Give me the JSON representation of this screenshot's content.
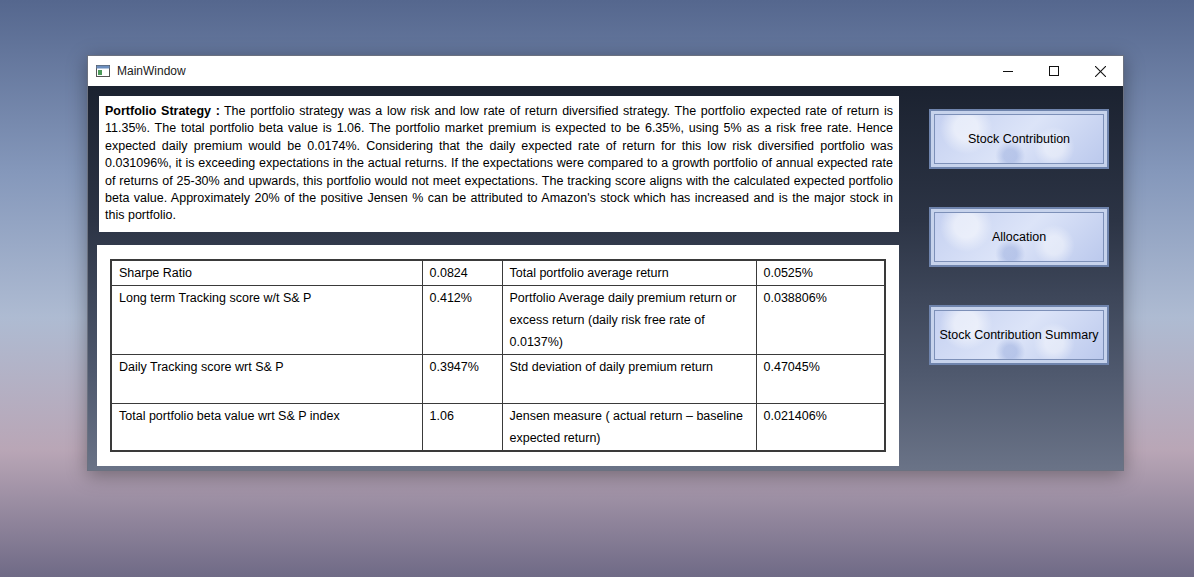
{
  "window": {
    "title": "MainWindow"
  },
  "strategy": {
    "heading": "Portfolio Strategy :",
    "body": "The portfolio strategy was a low risk and low rate of return diversified strategy.  The portfolio expected rate of return is 11.35%. The total portfolio beta value is 1.06. The portfolio market premium is expected to be 6.35%, using 5% as a risk free rate. Hence expected daily premium would be 0.0174%. Considering that the daily expected rate of return for this low risk diversified portfolio was 0.031096%, it is exceeding expectations in the actual returns.  If the expectations were compared to a growth portfolio of annual expected rate of returns of 25-30% and upwards, this portfolio would not meet expectations. The tracking score aligns with the calculated expected portfolio beta value. Approximately 20% of the positive Jensen % can be attributed to Amazon's stock which has increased and is the major stock in this portfolio."
  },
  "metrics": {
    "rows": [
      {
        "cells": [
          "Sharpe Ratio",
          "0.0824",
          "Total portfolio average return",
          "0.0525%"
        ]
      },
      {
        "cells": [
          "Long term Tracking score w/t S& P",
          "0.412%",
          "Portfolio Average daily premium return or excess return (daily risk free rate of 0.0137%)",
          "0.038806%"
        ]
      },
      {
        "cells": [
          "Daily Tracking score wrt S& P",
          "0.3947%",
          "Std deviation of daily premium return",
          "0.47045%"
        ]
      },
      {
        "cells": [
          "Total portfolio beta value wrt S& P index",
          "1.06",
          "Jensen measure ( actual return – baseline expected return)",
          "0.021406%"
        ]
      }
    ]
  },
  "buttons": [
    {
      "label": "Stock Contribution"
    },
    {
      "label": "Allocation"
    },
    {
      "label": "Stock Contribution Summary"
    }
  ]
}
